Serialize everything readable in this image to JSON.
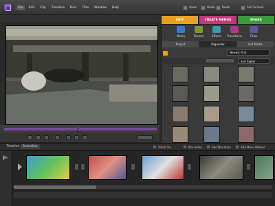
{
  "menubar": {
    "items": [
      "File",
      "Edit",
      "Clip",
      "Timeline",
      "Disc",
      "Title",
      "Window",
      "Help"
    ],
    "buttons": [
      "Save",
      "Undo",
      "Redo",
      "Full Screen"
    ]
  },
  "tabs": {
    "edit": "EDIT",
    "create_menus": "CREATE MENUS",
    "share": "SHARE"
  },
  "categories": [
    "Media",
    "Themes",
    "Effects",
    "Transitions",
    "Titles"
  ],
  "subtabs": [
    "Project",
    "Organizer",
    "Get Media"
  ],
  "sort": {
    "value": "Newest First"
  },
  "filter": {
    "value": "and higher"
  },
  "timeline": {
    "tabs": [
      "Timeline",
      "Sceneline"
    ],
    "actions": [
      "Smart Fix",
      "Mix Audio",
      "Add Narration",
      "Add Menu Marker"
    ]
  },
  "colors": {
    "edit_tab": "#e8a020",
    "create_tab": "#c03a7a",
    "share_tab": "#3a9a3a",
    "scrubber": "#7a4a9a"
  }
}
